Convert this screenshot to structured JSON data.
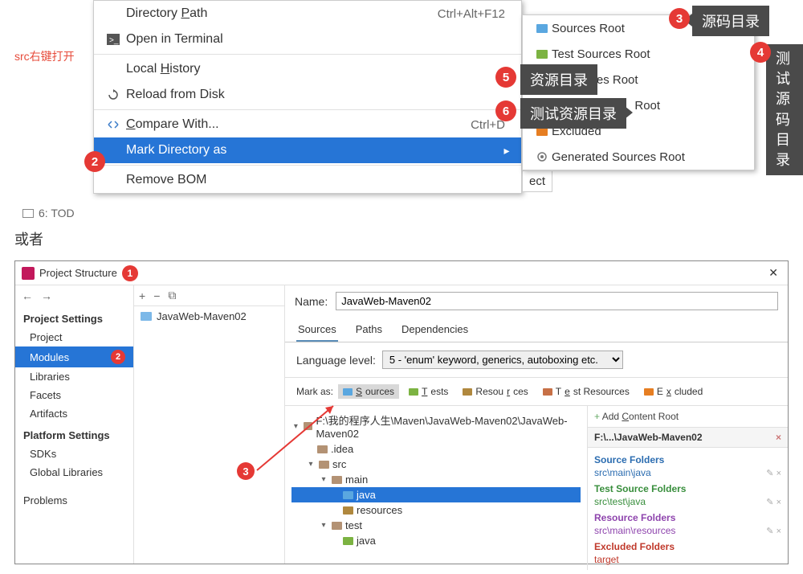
{
  "annotations": {
    "src_right_click": "src右键打开",
    "or_text": "或者",
    "tooltip3": "源码目录",
    "tooltip4_line1": "测试",
    "tooltip4_line2": "源码",
    "tooltip4_line3": "目录",
    "tooltip5": "资源目录",
    "tooltip6": "测试资源目录"
  },
  "context_menu": {
    "items": [
      {
        "icon": "",
        "label": "Directory Path",
        "underline": "P",
        "shortcut": "Ctrl+Alt+F12"
      },
      {
        "icon": "terminal",
        "label": "Open in Terminal",
        "shortcut": ""
      },
      {
        "sep": true
      },
      {
        "icon": "",
        "label": "Local History",
        "underline": "H",
        "shortcut": "",
        "arrow": true
      },
      {
        "icon": "reload",
        "label": "Reload from Disk",
        "shortcut": ""
      },
      {
        "sep": true
      },
      {
        "icon": "compare",
        "label": "Compare With...",
        "underline": "C",
        "shortcut": "Ctrl+D"
      },
      {
        "icon": "",
        "label": "Mark Directory as",
        "shortcut": "",
        "arrow": true,
        "selected": true
      },
      {
        "sep": true
      },
      {
        "icon": "",
        "label": "Remove BOM",
        "shortcut": ""
      }
    ],
    "bottom_fragment": "6: TOD"
  },
  "submenu": {
    "items": [
      {
        "color": "#5aa7e0",
        "label": "Sources Root"
      },
      {
        "color": "#7cb342",
        "label": "Test Sources Root"
      },
      {
        "color": "#b0883e",
        "label": "Resources Root",
        "partial": true,
        "visible": "es Root"
      },
      {
        "color": "#c77046",
        "label": "Test Resources Root",
        "partial": true,
        "visible": "Root"
      },
      {
        "color": "#e67e22",
        "label": "Excluded"
      },
      {
        "color": "gear",
        "label": "Generated Sources Root"
      }
    ],
    "ect_fragment": "ect"
  },
  "project_structure": {
    "title": "Project Structure",
    "sidebar": {
      "section1": "Project Settings",
      "items1": [
        "Project",
        "Modules",
        "Libraries",
        "Facets",
        "Artifacts"
      ],
      "section2": "Platform Settings",
      "items2": [
        "SDKs",
        "Global Libraries"
      ],
      "section3": "Problems"
    },
    "module_list": [
      "JavaWeb-Maven02"
    ],
    "name_label": "Name:",
    "name_value": "JavaWeb-Maven02",
    "tabs": [
      "Sources",
      "Paths",
      "Dependencies"
    ],
    "lang_label": "Language level:",
    "lang_value": "5 - 'enum' keyword, generics, autoboxing etc.",
    "mark_as": "Mark as:",
    "mark_buttons": [
      {
        "label": "Sources",
        "color": "#5aa7e0",
        "active": true
      },
      {
        "label": "Tests",
        "color": "#7cb342"
      },
      {
        "label": "Resources",
        "color": "#b0883e"
      },
      {
        "label": "Test Resources",
        "color": "#c77046"
      },
      {
        "label": "Excluded",
        "color": "#e67e22"
      }
    ],
    "tree": {
      "root": "F:\\我的程序人生\\Maven\\JavaWeb-Maven02\\JavaWeb-Maven02",
      "nodes": [
        {
          "indent": 1,
          "arrow": "",
          "label": ".idea",
          "color": "#b39274"
        },
        {
          "indent": 1,
          "arrow": "v",
          "label": "src",
          "color": "#b39274"
        },
        {
          "indent": 2,
          "arrow": "v",
          "label": "main",
          "color": "#b39274"
        },
        {
          "indent": 3,
          "arrow": "",
          "label": "java",
          "color": "#5aa7e0",
          "selected": true
        },
        {
          "indent": 3,
          "arrow": "",
          "label": "resources",
          "color": "#b0883e"
        },
        {
          "indent": 2,
          "arrow": "v",
          "label": "test",
          "color": "#b39274"
        },
        {
          "indent": 3,
          "arrow": "",
          "label": "java",
          "color": "#7cb342"
        }
      ]
    },
    "right_panel": {
      "add": "+ Add Content Root",
      "path": "F:\\...\\JavaWeb-Maven02",
      "sections": [
        {
          "title": "Source Folders",
          "color": "#2b6cb0",
          "path": "src\\main\\java"
        },
        {
          "title": "Test Source Folders",
          "color": "#388e3c",
          "path": "src\\test\\java"
        },
        {
          "title": "Resource Folders",
          "color": "#8e44ad",
          "path": "src\\main\\resources"
        },
        {
          "title": "Excluded Folders",
          "color": "#c0392b",
          "path": "target"
        }
      ]
    }
  }
}
